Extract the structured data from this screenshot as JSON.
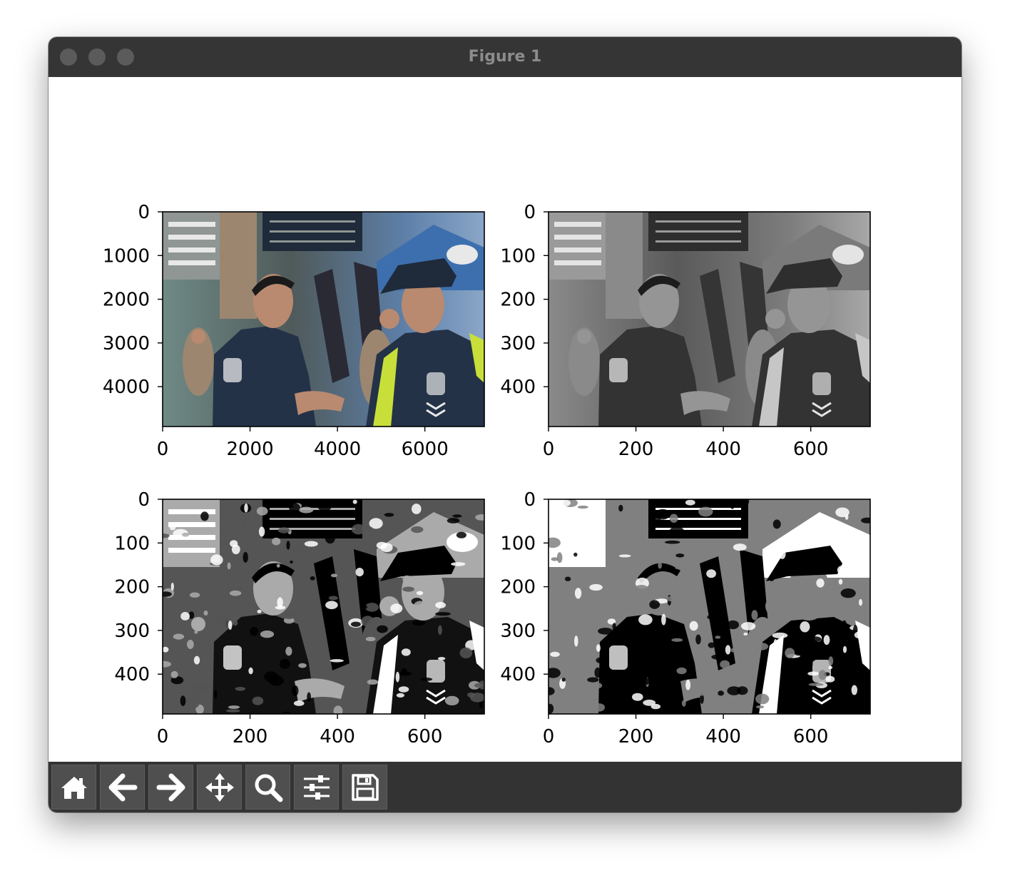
{
  "window": {
    "title": "Figure 1"
  },
  "toolbar": {
    "buttons": [
      {
        "name": "home-button",
        "icon": "home-icon"
      },
      {
        "name": "back-button",
        "icon": "arrow-left-icon"
      },
      {
        "name": "forward-button",
        "icon": "arrow-right-icon"
      },
      {
        "name": "pan-button",
        "icon": "move-icon"
      },
      {
        "name": "zoom-button",
        "icon": "magnifier-icon"
      },
      {
        "name": "configure-subplots-button",
        "icon": "sliders-icon"
      },
      {
        "name": "save-button",
        "icon": "floppy-disk-icon"
      }
    ]
  },
  "chart_data": [
    {
      "type": "image",
      "content": "color photo",
      "xlim": [
        0,
        7360
      ],
      "ylim": [
        4912,
        0
      ],
      "xticks": [
        "0",
        "2000",
        "4000",
        "6000"
      ],
      "yticks": [
        "0",
        "1000",
        "2000",
        "3000",
        "4000"
      ]
    },
    {
      "type": "image",
      "content": "grayscale photo",
      "xlim": [
        0,
        736
      ],
      "ylim": [
        491,
        0
      ],
      "xticks": [
        "0",
        "200",
        "400",
        "600"
      ],
      "yticks": [
        "0",
        "100",
        "200",
        "300",
        "400"
      ]
    },
    {
      "type": "image",
      "content": "4-level posterized grayscale",
      "levels": 4,
      "xlim": [
        0,
        736
      ],
      "ylim": [
        491,
        0
      ],
      "xticks": [
        "0",
        "200",
        "400",
        "600"
      ],
      "yticks": [
        "0",
        "100",
        "200",
        "300",
        "400"
      ]
    },
    {
      "type": "image",
      "content": "3-level posterized grayscale",
      "levels": 3,
      "xlim": [
        0,
        736
      ],
      "ylim": [
        491,
        0
      ],
      "xticks": [
        "0",
        "200",
        "400",
        "600"
      ],
      "yticks": [
        "0",
        "100",
        "200",
        "300",
        "400"
      ]
    }
  ]
}
